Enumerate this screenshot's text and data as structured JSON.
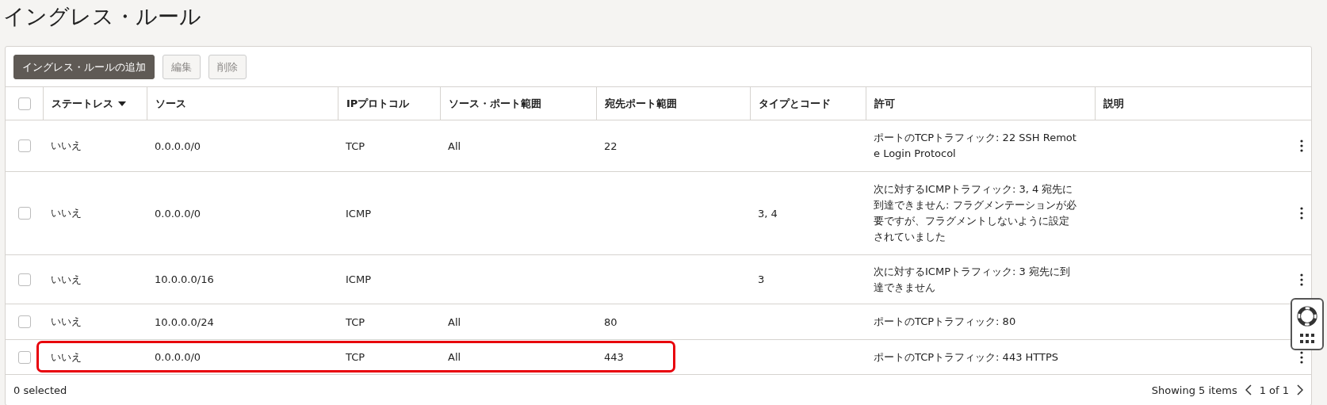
{
  "title": "イングレス・ルール",
  "toolbar": [
    {
      "label": "イングレス・ルールの追加",
      "disabled": false
    },
    {
      "label": "編集",
      "disabled": true
    },
    {
      "label": "削除",
      "disabled": true
    }
  ],
  "columns": [
    {
      "label": "ステートレス",
      "sorted": true
    },
    {
      "label": "ソース",
      "sorted": false
    },
    {
      "label": "IPプロトコル",
      "sorted": false
    },
    {
      "label": "ソース・ポート範囲",
      "sorted": false
    },
    {
      "label": "宛先ポート範囲",
      "sorted": false
    },
    {
      "label": "タイプとコード",
      "sorted": false
    },
    {
      "label": "許可",
      "sorted": false
    },
    {
      "label": "説明",
      "sorted": false
    }
  ],
  "header_checked": false,
  "rows": [
    {
      "checked": false,
      "highlighted": false,
      "cells": [
        "いいえ",
        "0.0.0.0/0",
        "TCP",
        "All",
        "22",
        "",
        "ポートのTCPトラフィック: 22 SSH Remote Login Protocol",
        ""
      ]
    },
    {
      "checked": false,
      "highlighted": false,
      "cells": [
        "いいえ",
        "0.0.0.0/0",
        "ICMP",
        "",
        "",
        "3, 4",
        "次に対するICMPトラフィック: 3, 4 宛先に到達できません: フラグメンテーションが必要ですが、フラグメントしないように設定されていました",
        ""
      ]
    },
    {
      "checked": false,
      "highlighted": false,
      "cells": [
        "いいえ",
        "10.0.0.0/16",
        "ICMP",
        "",
        "",
        "3",
        "次に対するICMPトラフィック: 3 宛先に到達できません",
        ""
      ]
    },
    {
      "checked": false,
      "highlighted": false,
      "cells": [
        "いいえ",
        "10.0.0.0/24",
        "TCP",
        "All",
        "80",
        "",
        "ポートのTCPトラフィック: 80",
        ""
      ]
    },
    {
      "checked": false,
      "highlighted": true,
      "cells": [
        "いいえ",
        "0.0.0.0/0",
        "TCP",
        "All",
        "443",
        "",
        "ポートのTCPトラフィック: 443 HTTPS",
        ""
      ]
    }
  ],
  "footer": {
    "selected": "0 selected",
    "showing": "Showing 5 items",
    "page": "1 of 1"
  }
}
